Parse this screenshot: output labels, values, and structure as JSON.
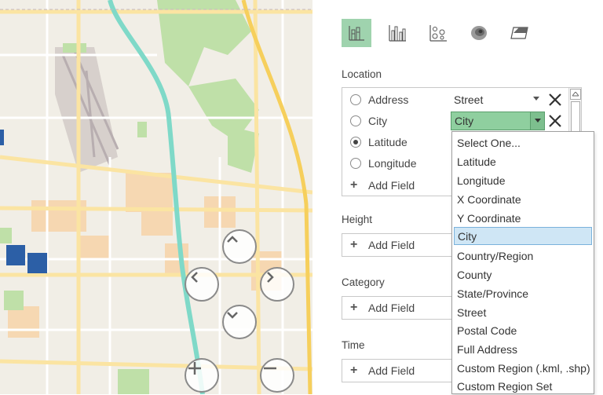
{
  "map": {
    "nav_controls": [
      "pan-up",
      "pan-left",
      "pan-right",
      "pan-down",
      "zoom-in",
      "zoom-out"
    ],
    "colors": {
      "road": "#fde9a6",
      "highway": "#7dd8c8",
      "park": "#b8dca0",
      "urban": "#f6cda0",
      "marker": "#2c5fa6"
    }
  },
  "chart_types": [
    {
      "name": "stacked-column",
      "active": true
    },
    {
      "name": "clustered-column",
      "active": false
    },
    {
      "name": "bubble",
      "active": false
    },
    {
      "name": "heat-map",
      "active": false
    },
    {
      "name": "region",
      "active": false
    }
  ],
  "location": {
    "label": "Location",
    "fields": [
      {
        "label": "Address",
        "checked": false,
        "value": "Street"
      },
      {
        "label": "City",
        "checked": false,
        "value": "City"
      },
      {
        "label": "Latitude",
        "checked": true
      },
      {
        "label": "Longitude",
        "checked": false
      }
    ],
    "add_field": "Add Field"
  },
  "height": {
    "label": "Height",
    "add_field": "Add Field"
  },
  "category": {
    "label": "Category",
    "add_field": "Add Field"
  },
  "time": {
    "label": "Time",
    "add_field": "Add Field"
  },
  "dropdown": {
    "selected": "City",
    "options": [
      "Select One...",
      "Latitude",
      "Longitude",
      "X Coordinate",
      "Y Coordinate",
      "City",
      "Country/Region",
      "County",
      "State/Province",
      "Street",
      "Postal Code",
      "Full Address",
      "Custom Region (.kml, .shp)",
      "Custom Region Set"
    ]
  },
  "accent": "#8fcf9f",
  "selection_blue": "#cfe6f5"
}
